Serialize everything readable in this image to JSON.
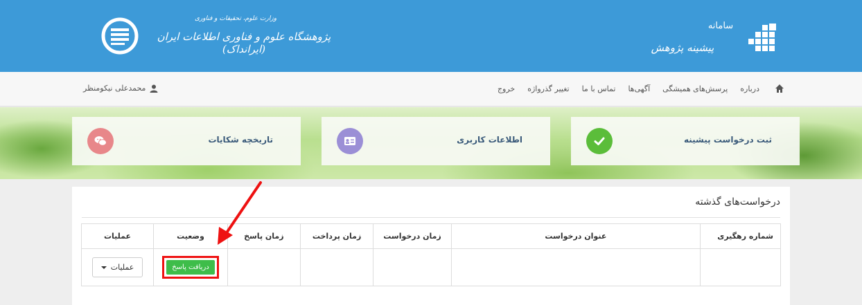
{
  "header": {
    "org_subtitle": "وزارت علوم، تحقیقات و فناوری",
    "org_name": "پژوهشگاه علوم و فناوری اطلاعات ایران (ایرانداک)",
    "brand_small": "سامانه",
    "brand_name": "پیشینه پژوهش",
    "color": "#3d9ad8"
  },
  "nav": {
    "items": [
      "درباره",
      "پرسش‌های همیشگی",
      "آگهی‌ها",
      "تماس با ما",
      "تغییر گذرواژه",
      "خروج"
    ],
    "user_name": "محمدعلی نیکومنظر"
  },
  "cards": [
    {
      "title": "ثبت درخواست پیشینه",
      "icon": "check-icon",
      "color": "#5bbd3a"
    },
    {
      "title": "اطلاعات کاربری",
      "icon": "id-card-icon",
      "color": "#9b8fd6"
    },
    {
      "title": "تاریخچه شکایات",
      "icon": "chat-bubbles-icon",
      "color": "#e8878a"
    }
  ],
  "panel": {
    "title": "درخواست‌های گذشته",
    "columns": [
      "شماره رهگیری",
      "عنوان درخواست",
      "زمان درخواست",
      "زمان پرداخت",
      "زمان پاسخ",
      "وضعیت",
      "عملیات"
    ],
    "row": {
      "tracking": "",
      "title": "",
      "request_time": "",
      "payment_time": "",
      "response_time": "",
      "status_label": "دریافت پاسخ",
      "ops_label": "عملیات"
    },
    "status_color": "#3ebd4a",
    "highlight_color": "#ee1111"
  }
}
